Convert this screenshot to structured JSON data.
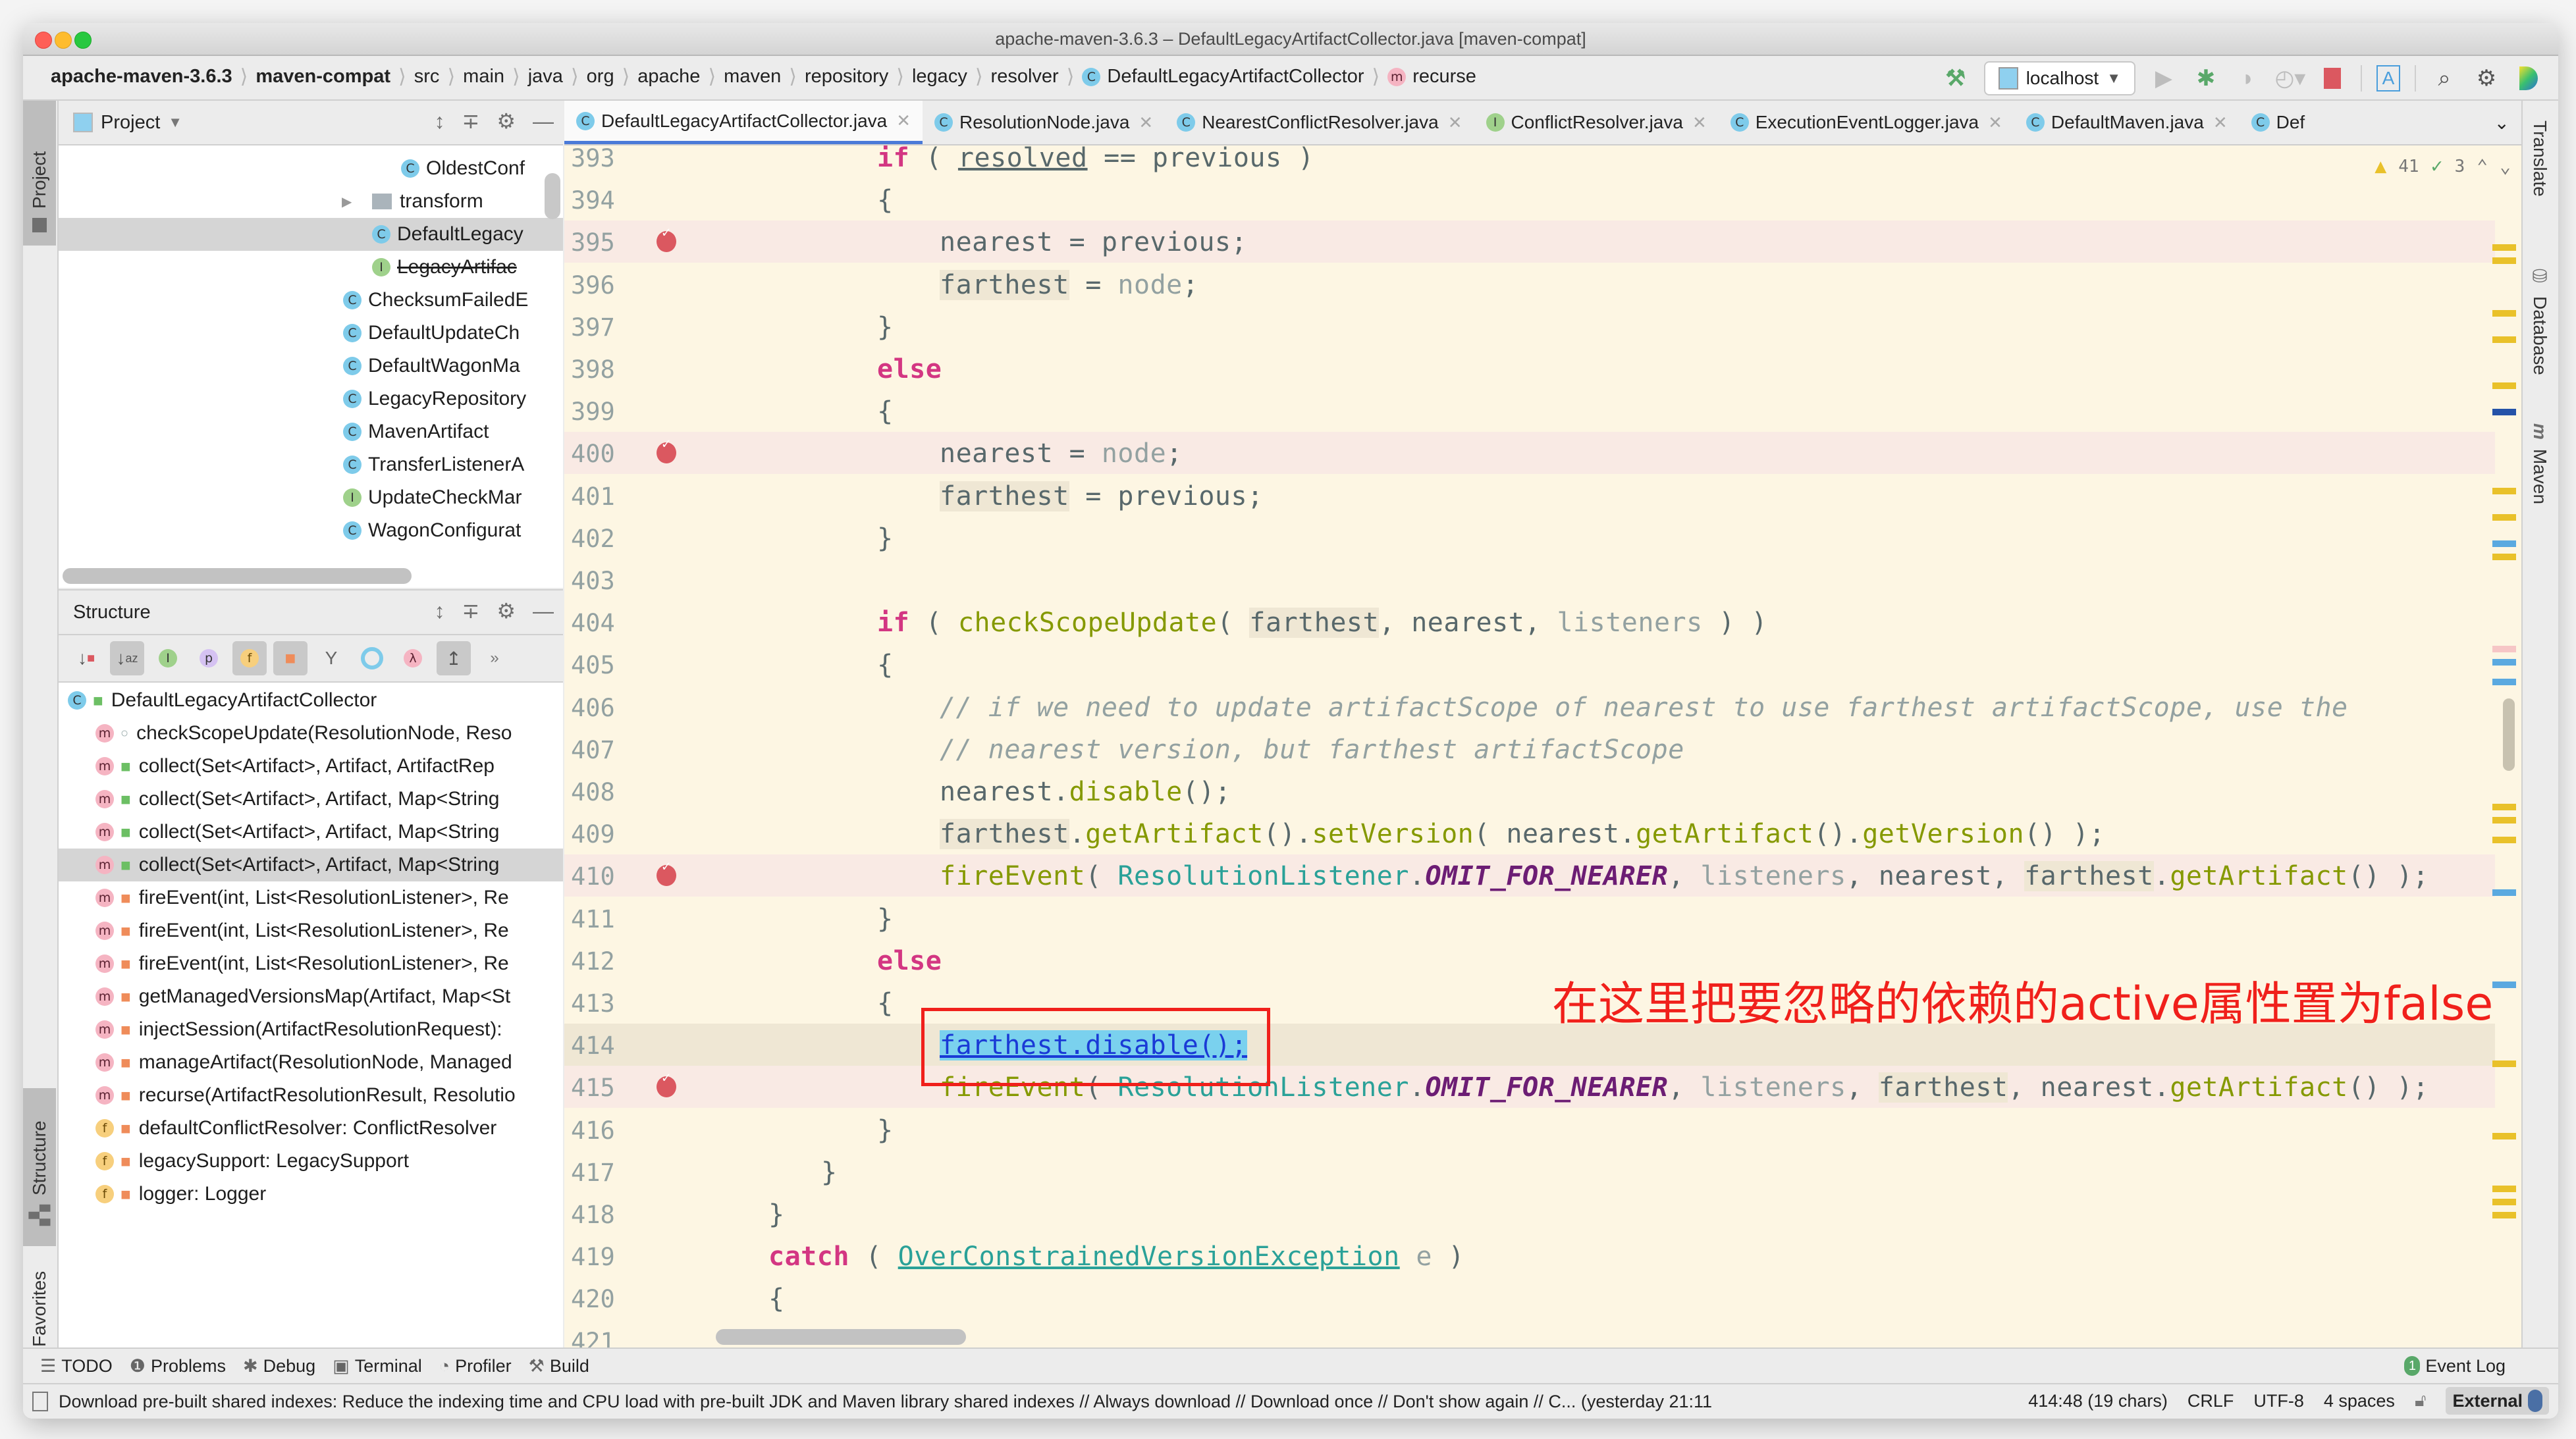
{
  "window": {
    "title": "apache-maven-3.6.3 – DefaultLegacyArtifactCollector.java [maven-compat]"
  },
  "breadcrumbs": [
    {
      "label": "apache-maven-3.6.3",
      "bold": true
    },
    {
      "label": "maven-compat",
      "bold": true
    },
    {
      "label": "src"
    },
    {
      "label": "main"
    },
    {
      "label": "java"
    },
    {
      "label": "org"
    },
    {
      "label": "apache"
    },
    {
      "label": "maven"
    },
    {
      "label": "repository"
    },
    {
      "label": "legacy"
    },
    {
      "label": "resolver"
    },
    {
      "label": "DefaultLegacyArtifactCollector",
      "icon": "class-icon"
    },
    {
      "label": "recurse",
      "icon": "method-icon"
    }
  ],
  "toolbar": {
    "run_config": "localhost",
    "icons": [
      "build-hammer-icon",
      "run-icon",
      "debug-icon",
      "coverage-icon",
      "profile-icon",
      "stop-icon",
      "translate-icon",
      "search-icon",
      "settings-icon",
      "toolbox-icon"
    ]
  },
  "left_stripe": {
    "project": "Project",
    "structure": "Structure",
    "favorites": "Favorites"
  },
  "right_stripe": {
    "translate": "Translate",
    "database": "Database",
    "maven": "Maven"
  },
  "project_panel": {
    "title": "Project",
    "items": [
      {
        "label": "OldestConf",
        "kind": "class",
        "indent": 3
      },
      {
        "label": "transform",
        "kind": "folder",
        "indent": 2,
        "expandable": true
      },
      {
        "label": "DefaultLegacy",
        "kind": "class",
        "indent": 2,
        "selected": true
      },
      {
        "label": "LegacyArtifac",
        "kind": "interface",
        "indent": 2,
        "deprecated": true
      },
      {
        "label": "ChecksumFailedE",
        "kind": "class",
        "indent": 1
      },
      {
        "label": "DefaultUpdateCh",
        "kind": "class",
        "indent": 1
      },
      {
        "label": "DefaultWagonMa",
        "kind": "class",
        "indent": 1
      },
      {
        "label": "LegacyRepository",
        "kind": "class",
        "indent": 1
      },
      {
        "label": "MavenArtifact",
        "kind": "class",
        "indent": 1
      },
      {
        "label": "TransferListenerA",
        "kind": "class",
        "indent": 1
      },
      {
        "label": "UpdateCheckMar",
        "kind": "interface",
        "indent": 1
      },
      {
        "label": "WagonConfigurat",
        "kind": "class",
        "indent": 1
      }
    ]
  },
  "structure_panel": {
    "title": "Structure",
    "root": "DefaultLegacyArtifactCollector",
    "items": [
      {
        "label": "checkScopeUpdate(ResolutionNode, Reso",
        "kind": "m",
        "access": "package"
      },
      {
        "label": "collect(Set<Artifact>, Artifact, ArtifactRep",
        "kind": "m",
        "access": "public"
      },
      {
        "label": "collect(Set<Artifact>, Artifact, Map<String",
        "kind": "m",
        "access": "public"
      },
      {
        "label": "collect(Set<Artifact>, Artifact, Map<String",
        "kind": "m",
        "access": "public"
      },
      {
        "label": "collect(Set<Artifact>, Artifact, Map<String",
        "kind": "m",
        "access": "public",
        "selected": true
      },
      {
        "label": "fireEvent(int, List<ResolutionListener>, Re",
        "kind": "m",
        "access": "private"
      },
      {
        "label": "fireEvent(int, List<ResolutionListener>, Re",
        "kind": "m",
        "access": "private"
      },
      {
        "label": "fireEvent(int, List<ResolutionListener>, Re",
        "kind": "m",
        "access": "private"
      },
      {
        "label": "getManagedVersionsMap(Artifact, Map<St",
        "kind": "m",
        "access": "private"
      },
      {
        "label": "injectSession(ArtifactResolutionRequest):",
        "kind": "m",
        "access": "private"
      },
      {
        "label": "manageArtifact(ResolutionNode, Managed",
        "kind": "m",
        "access": "private"
      },
      {
        "label": "recurse(ArtifactResolutionResult, Resolutio",
        "kind": "m",
        "access": "private"
      },
      {
        "label": "defaultConflictResolver: ConflictResolver",
        "kind": "f",
        "access": "private"
      },
      {
        "label": "legacySupport: LegacySupport",
        "kind": "f",
        "access": "private"
      },
      {
        "label": "logger: Logger",
        "kind": "f",
        "access": "private"
      }
    ]
  },
  "editor": {
    "tabs": [
      {
        "label": "DefaultLegacyArtifactCollector.java",
        "kind": "class",
        "active": true
      },
      {
        "label": "ResolutionNode.java",
        "kind": "class"
      },
      {
        "label": "NearestConflictResolver.java",
        "kind": "class"
      },
      {
        "label": "ConflictResolver.java",
        "kind": "interface"
      },
      {
        "label": "ExecutionEventLogger.java",
        "kind": "class"
      },
      {
        "label": "DefaultMaven.java",
        "kind": "class"
      },
      {
        "label": "Def",
        "kind": "class"
      }
    ],
    "inspections": {
      "warnings": "41",
      "typos": "3"
    },
    "lines": [
      {
        "n": "393",
        "indent": 2,
        "html": "<span class='kw'>if</span> ( <span class='ul'>resolved</span> == previous )"
      },
      {
        "n": "394",
        "indent": 2,
        "html": "{"
      },
      {
        "n": "395",
        "indent": 3,
        "bp": true,
        "html": "nearest = previous;"
      },
      {
        "n": "396",
        "indent": 3,
        "html": "<span class='hl'>farthest</span> = <span class='par'>node</span>;"
      },
      {
        "n": "397",
        "indent": 2,
        "html": "}"
      },
      {
        "n": "398",
        "indent": 2,
        "html": "<span class='kw'>else</span>"
      },
      {
        "n": "399",
        "indent": 2,
        "html": "{"
      },
      {
        "n": "400",
        "indent": 3,
        "bp": true,
        "html": "nearest = <span class='par'>node</span>;"
      },
      {
        "n": "401",
        "indent": 3,
        "html": "<span class='hl'>farthest</span> = previous;"
      },
      {
        "n": "402",
        "indent": 2,
        "html": "}"
      },
      {
        "n": "403",
        "indent": 2,
        "html": ""
      },
      {
        "n": "404",
        "indent": 2,
        "html": "<span class='kw'>if</span> ( <span class='fn'>checkScopeUpdate</span>( <span class='hl'>farthest</span>, nearest, <span class='par'>listeners</span> ) )"
      },
      {
        "n": "405",
        "indent": 2,
        "html": "{"
      },
      {
        "n": "406",
        "indent": 3,
        "html": "<span class='cm'>// if we need to update artifactScope of nearest to use farthest artifactScope, use the</span>"
      },
      {
        "n": "407",
        "indent": 3,
        "html": "<span class='cm'>// nearest version, but farthest artifactScope</span>"
      },
      {
        "n": "408",
        "indent": 3,
        "html": "nearest.<span class='fn'>disable</span>();"
      },
      {
        "n": "409",
        "indent": 3,
        "html": "<span class='hl'>farthest</span>.<span class='fn'>getArtifact</span>().<span class='fn'>setVersion</span>( nearest.<span class='fn'>getArtifact</span>().<span class='fn'>getVersion</span>() );"
      },
      {
        "n": "410",
        "indent": 3,
        "bp": true,
        "html": "<span class='fn'>fireEvent</span>( <span class='ty'>ResolutionListener</span>.<span class='cst'>OMIT_FOR_NEARER</span>, <span class='par'>listeners</span>, nearest, <span class='hl'>farthest</span>.<span class='fn'>getArtifact</span>() );"
      },
      {
        "n": "411",
        "indent": 2,
        "html": "}"
      },
      {
        "n": "412",
        "indent": 2,
        "html": "<span class='kw'>else</span>"
      },
      {
        "n": "413",
        "indent": 2,
        "html": "{"
      },
      {
        "n": "414",
        "indent": 3,
        "cur": true,
        "html": "<span class='sel-txt'>farthest.disable();</span>"
      },
      {
        "n": "415",
        "indent": 3,
        "bp": true,
        "html": "<span class='fn'>fireEvent</span>( <span class='ty'>ResolutionListener</span>.<span class='cst'>OMIT_FOR_NEARER</span>, <span class='par'>listeners</span>, <span class='hl'>farthest</span>, nearest.<span class='fn'>getArtifact</span>() );"
      },
      {
        "n": "416",
        "indent": 2,
        "html": "}"
      },
      {
        "n": "417",
        "indent": 1,
        "html": "}"
      },
      {
        "n": "418",
        "indent": 0,
        "html": "}"
      },
      {
        "n": "419",
        "indent": 0,
        "html": "<span class='kw'>catch</span> ( <span class='ty ul'>OverConstrainedVersionException</span> <span class='par'>e</span> )"
      },
      {
        "n": "420",
        "indent": 0,
        "html": "{"
      },
      {
        "n": "421",
        "indent": 0,
        "html": ""
      }
    ],
    "annotation": "在这里把要忽略的依赖的active属性置为false"
  },
  "bottom_tools": [
    {
      "label": "TODO",
      "icon": "list-icon"
    },
    {
      "label": "Problems",
      "icon": "problems-icon"
    },
    {
      "label": "Debug",
      "icon": "debug-icon"
    },
    {
      "label": "Terminal",
      "icon": "terminal-icon"
    },
    {
      "label": "Profiler",
      "icon": "profiler-icon"
    },
    {
      "label": "Build",
      "icon": "build-hammer-icon"
    }
  ],
  "event_log": {
    "label": "Event Log",
    "count": "1"
  },
  "status": {
    "message": "Download pre-built shared indexes: Reduce the indexing time and CPU load with pre-built JDK and Maven library shared indexes // Always download // Download once // Don't show again // C... (yesterday 21:11",
    "position": "414:48 (19 chars)",
    "line_sep": "CRLF",
    "encoding": "UTF-8",
    "indent": "4 spaces",
    "vcs": "External"
  }
}
